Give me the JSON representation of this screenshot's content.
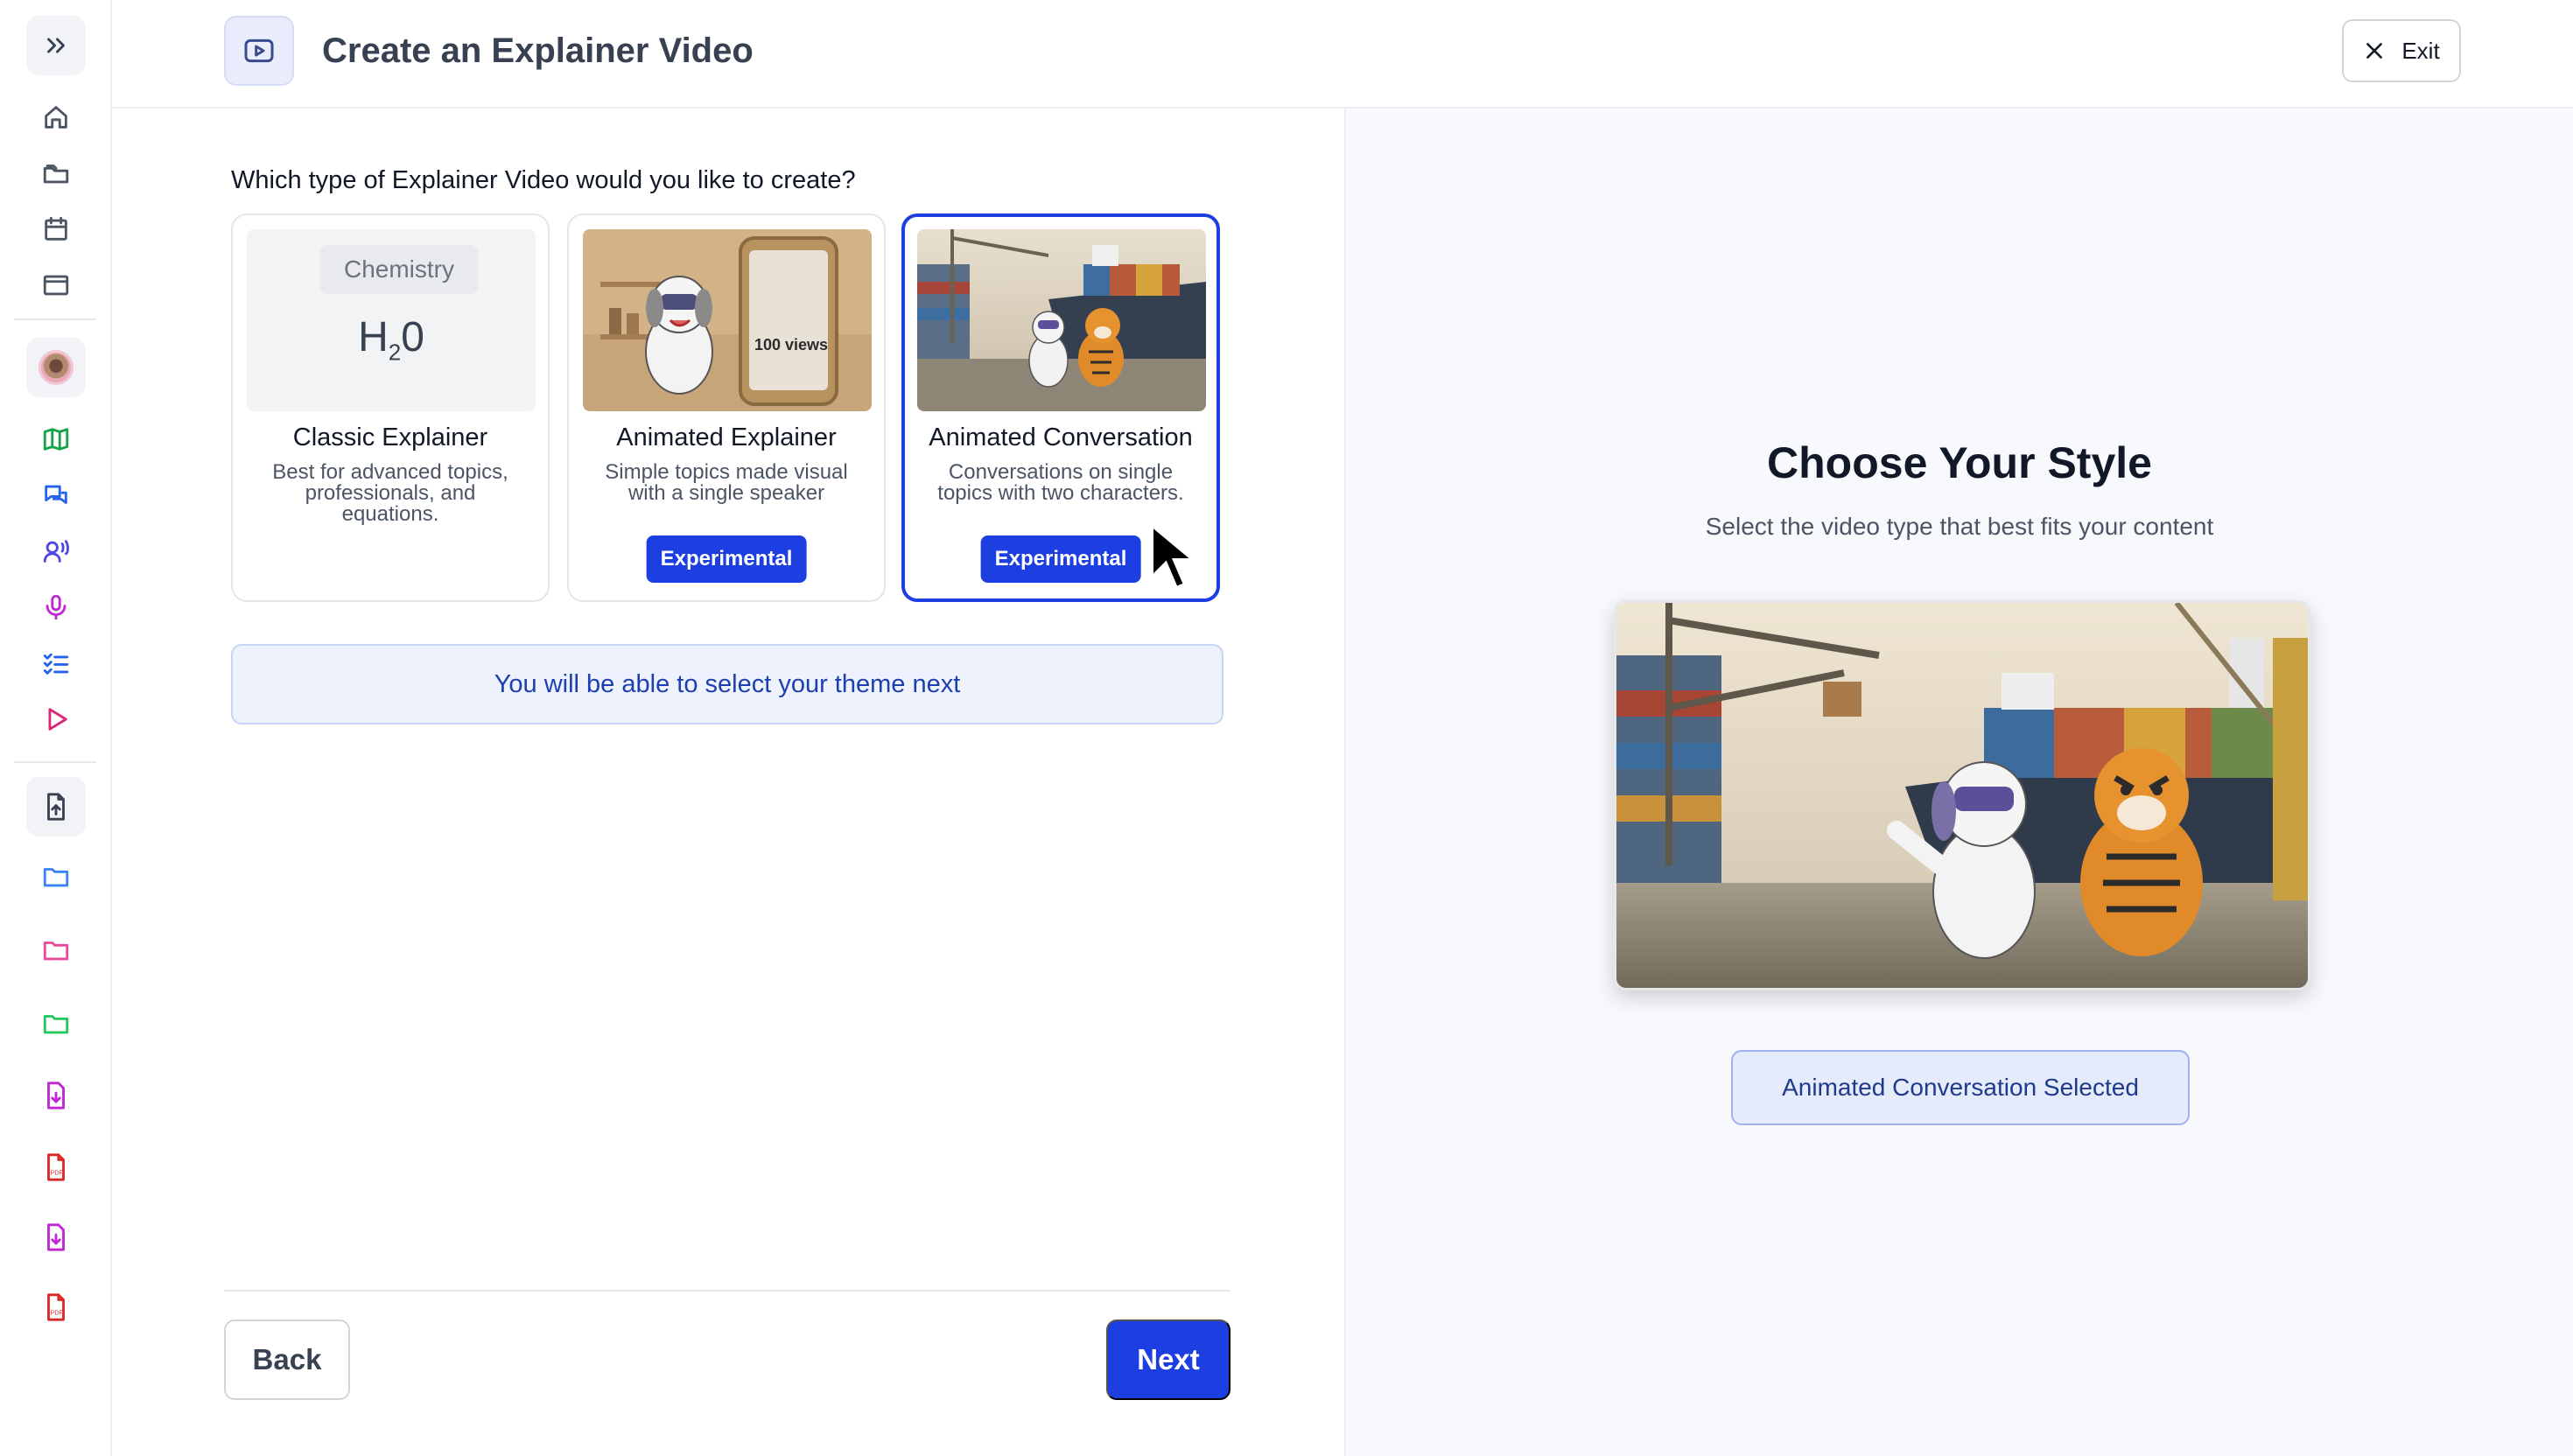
{
  "header": {
    "title": "Create an Explainer Video",
    "exit_label": "Exit"
  },
  "sidebar": {
    "icons": [
      "expand-icon",
      "home-icon",
      "folders-icon",
      "calendar-icon",
      "window-icon",
      "avatar",
      "map-icon",
      "chat-icon",
      "speaker-icon",
      "microphone-icon",
      "checklist-icon",
      "play-icon",
      "upload-file-icon",
      "folder-icon",
      "folder-pink-icon",
      "folder-green-icon",
      "download-file-icon",
      "pdf-icon",
      "download-file-icon",
      "pdf-icon"
    ]
  },
  "main": {
    "question": "Which type of Explainer Video would you like to create?",
    "cards": [
      {
        "thumb_label": "Chemistry",
        "formula_h": "H",
        "formula_sub": "2",
        "formula_o": "0",
        "title": "Classic Explainer",
        "description": "Best for advanced topics, professionals, and equations.",
        "badge": ""
      },
      {
        "thumb_caption": "100 views",
        "title": "Animated Explainer",
        "description": "Simple topics made visual with a single speaker",
        "badge": "Experimental"
      },
      {
        "title": "Animated Conversation",
        "description": "Conversations on single topics with two characters.",
        "badge": "Experimental",
        "selected": true
      }
    ],
    "notice": "You will be able to select your theme next",
    "back_label": "Back",
    "next_label": "Next"
  },
  "preview_panel": {
    "title": "Choose Your Style",
    "subtitle": "Select the video type that best fits your content",
    "selected_label": "Animated Conversation Selected"
  },
  "colors": {
    "accent": "#1d3ee0",
    "notice_bg": "#eef2fd",
    "panel_bg": "#f8f9fc"
  }
}
